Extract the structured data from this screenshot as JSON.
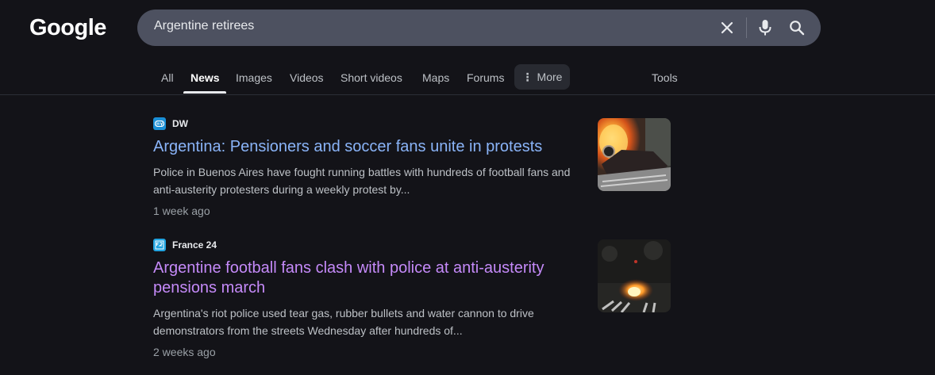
{
  "header": {
    "logo_text": "Google",
    "search": {
      "value": "Argentine retirees"
    },
    "icons": [
      "clear-icon",
      "mic-icon",
      "search-icon"
    ]
  },
  "tabs": [
    {
      "label": "All",
      "active": false
    },
    {
      "label": "News",
      "active": true
    },
    {
      "label": "Images",
      "active": false
    },
    {
      "label": "Videos",
      "active": false
    },
    {
      "label": "Short videos",
      "active": false
    },
    {
      "label": "Maps",
      "active": false
    },
    {
      "label": "Forums",
      "active": false
    }
  ],
  "more_label": "More",
  "tools_label": "Tools",
  "results": [
    {
      "source": "DW",
      "favicon_color": "#1a8fd6",
      "title": "Argentina: Pensioners and soccer fans unite in protests",
      "visited": false,
      "snippet": "Police in Buenos Aires have fought running battles with hundreds of football fans and anti-austerity protesters during a weekly protest by...",
      "age": "1 week ago",
      "thumbnail": "burning-car-thumbnail"
    },
    {
      "source": "France 24",
      "favicon_color": "#21a4e0",
      "title": "Argentine football fans clash with police at anti-austerity pensions march",
      "visited": true,
      "snippet": "Argentina's riot police used tear gas, rubber bullets and water cannon to drive demonstrators from the streets Wednesday after hundreds of...",
      "age": "2 weeks ago",
      "thumbnail": "street-fire-thumbnail"
    }
  ],
  "colors": {
    "background": "#131318",
    "link_unvisited": "#8ab4f8",
    "link_visited": "#c58af9",
    "search_box": "#4d5160"
  }
}
